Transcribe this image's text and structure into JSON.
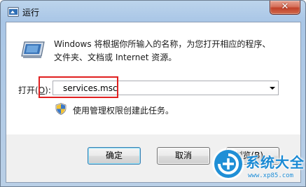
{
  "window": {
    "title": "运行",
    "close_label": "✕"
  },
  "description": {
    "line1": "Windows 将根据你所输入的名称，为您打开相应的程序、",
    "line2": "文件夹、文档或 Internet 资源。"
  },
  "open_field": {
    "label_prefix": "打开(",
    "label_hotkey": "O",
    "label_suffix": "):",
    "value": "services.msc"
  },
  "admin_note": "使用管理权限创建此任务。",
  "buttons": {
    "ok": "确定",
    "cancel": "取消",
    "browse": "浏览(B)..."
  },
  "watermark": {
    "title": "系统大全",
    "url": "www.xp85.com"
  },
  "colors": {
    "highlight": "#e02020",
    "watermark": "#1b8ad4"
  }
}
